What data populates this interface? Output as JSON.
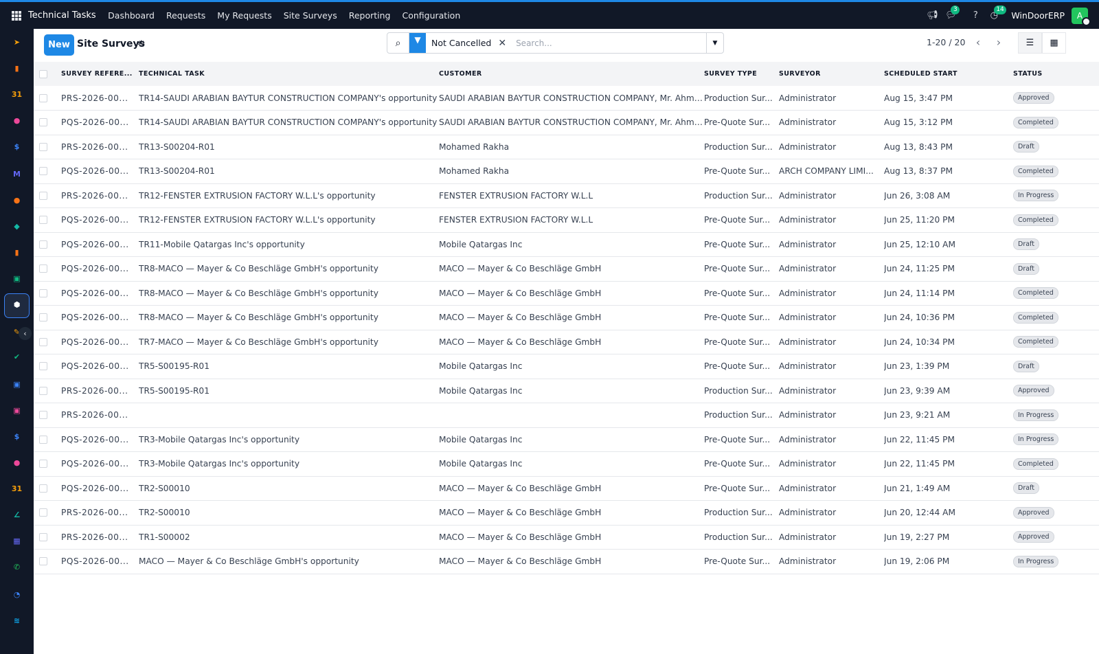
{
  "app": {
    "name": "Technical Tasks"
  },
  "menu": [
    "Dashboard",
    "Requests",
    "My Requests",
    "Site Surveys",
    "Reporting",
    "Configuration"
  ],
  "systray": {
    "messages_count": "3",
    "activities_count": "14",
    "company": "WinDoorERP",
    "avatar_initial": "A"
  },
  "control": {
    "new_label": "New",
    "title": "Site Surveys",
    "facet": "Not Cancelled",
    "search_placeholder": "Search...",
    "pager": "1-20 / 20"
  },
  "table": {
    "columns": [
      "SURVEY REFERE...",
      "TECHNICAL TASK",
      "CUSTOMER",
      "SURVEY TYPE",
      "SURVEYOR",
      "SCHEDULED START",
      "STATUS"
    ],
    "rows": [
      {
        "ref": "PRS-2026-00...",
        "task": "TR14-SAUDI ARABIAN BAYTUR CONSTRUCTION COMPANY's opportunity",
        "customer": "SAUDI ARABIAN BAYTUR CONSTRUCTION COMPANY, Mr. Ahmad",
        "type": "Production Sur...",
        "surveyor": "Administrator",
        "start": "Aug 15, 3:47 PM",
        "status": "Approved"
      },
      {
        "ref": "PQS-2026-00...",
        "task": "TR14-SAUDI ARABIAN BAYTUR CONSTRUCTION COMPANY's opportunity",
        "customer": "SAUDI ARABIAN BAYTUR CONSTRUCTION COMPANY, Mr. Ahmad",
        "type": "Pre-Quote Sur...",
        "surveyor": "Administrator",
        "start": "Aug 15, 3:12 PM",
        "status": "Completed"
      },
      {
        "ref": "PRS-2026-00...",
        "task": "TR13-S00204-R01",
        "customer": "Mohamed Rakha",
        "type": "Production Sur...",
        "surveyor": "Administrator",
        "start": "Aug 13, 8:43 PM",
        "status": "Draft"
      },
      {
        "ref": "PQS-2026-00...",
        "task": "TR13-S00204-R01",
        "customer": "Mohamed Rakha",
        "type": "Pre-Quote Sur...",
        "surveyor": "ARCH COMPANY LIMI...",
        "start": "Aug 13, 8:37 PM",
        "status": "Completed"
      },
      {
        "ref": "PRS-2026-00...",
        "task": "TR12-FENSTER EXTRUSION FACTORY W.L.L's opportunity",
        "customer": "FENSTER EXTRUSION FACTORY W.L.L",
        "type": "Production Sur...",
        "surveyor": "Administrator",
        "start": "Jun 26, 3:08 AM",
        "status": "In Progress"
      },
      {
        "ref": "PQS-2026-00...",
        "task": "TR12-FENSTER EXTRUSION FACTORY W.L.L's opportunity",
        "customer": "FENSTER EXTRUSION FACTORY W.L.L",
        "type": "Pre-Quote Sur...",
        "surveyor": "Administrator",
        "start": "Jun 25, 11:20 PM",
        "status": "Completed"
      },
      {
        "ref": "PQS-2026-00...",
        "task": "TR11-Mobile Qatargas Inc's opportunity",
        "customer": "Mobile Qatargas Inc",
        "type": "Pre-Quote Sur...",
        "surveyor": "Administrator",
        "start": "Jun 25, 12:10 AM",
        "status": "Draft"
      },
      {
        "ref": "PQS-2026-00...",
        "task": "TR8-MACO — Mayer & Co Beschläge GmbH's opportunity",
        "customer": "MACO — Mayer & Co Beschläge GmbH",
        "type": "Pre-Quote Sur...",
        "surveyor": "Administrator",
        "start": "Jun 24, 11:25 PM",
        "status": "Draft"
      },
      {
        "ref": "PQS-2026-00...",
        "task": "TR8-MACO — Mayer & Co Beschläge GmbH's opportunity",
        "customer": "MACO — Mayer & Co Beschläge GmbH",
        "type": "Pre-Quote Sur...",
        "surveyor": "Administrator",
        "start": "Jun 24, 11:14 PM",
        "status": "Completed"
      },
      {
        "ref": "PQS-2026-00...",
        "task": "TR8-MACO — Mayer & Co Beschläge GmbH's opportunity",
        "customer": "MACO — Mayer & Co Beschläge GmbH",
        "type": "Pre-Quote Sur...",
        "surveyor": "Administrator",
        "start": "Jun 24, 10:36 PM",
        "status": "Completed"
      },
      {
        "ref": "PQS-2026-00...",
        "task": "TR7-MACO — Mayer & Co Beschläge GmbH's opportunity",
        "customer": "MACO — Mayer & Co Beschläge GmbH",
        "type": "Pre-Quote Sur...",
        "surveyor": "Administrator",
        "start": "Jun 24, 10:34 PM",
        "status": "Completed"
      },
      {
        "ref": "PQS-2026-00...",
        "task": "TR5-S00195-R01",
        "customer": "Mobile Qatargas Inc",
        "type": "Pre-Quote Sur...",
        "surveyor": "Administrator",
        "start": "Jun 23, 1:39 PM",
        "status": "Draft"
      },
      {
        "ref": "PRS-2026-00...",
        "task": "TR5-S00195-R01",
        "customer": "Mobile Qatargas Inc",
        "type": "Production Sur...",
        "surveyor": "Administrator",
        "start": "Jun 23, 9:39 AM",
        "status": "Approved"
      },
      {
        "ref": "PRS-2026-00...",
        "task": "",
        "customer": "",
        "type": "Production Sur...",
        "surveyor": "Administrator",
        "start": "Jun 23, 9:21 AM",
        "status": "In Progress"
      },
      {
        "ref": "PQS-2026-00...",
        "task": "TR3-Mobile Qatargas Inc's opportunity",
        "customer": "Mobile Qatargas Inc",
        "type": "Pre-Quote Sur...",
        "surveyor": "Administrator",
        "start": "Jun 22, 11:45 PM",
        "status": "In Progress"
      },
      {
        "ref": "PQS-2026-00...",
        "task": "TR3-Mobile Qatargas Inc's opportunity",
        "customer": "Mobile Qatargas Inc",
        "type": "Pre-Quote Sur...",
        "surveyor": "Administrator",
        "start": "Jun 22, 11:45 PM",
        "status": "Completed"
      },
      {
        "ref": "PQS-2026-00...",
        "task": "TR2-S00010",
        "customer": "MACO — Mayer & Co Beschläge GmbH",
        "type": "Pre-Quote Sur...",
        "surveyor": "Administrator",
        "start": "Jun 21, 1:49 AM",
        "status": "Draft"
      },
      {
        "ref": "PRS-2026-00...",
        "task": "TR2-S00010",
        "customer": "MACO — Mayer & Co Beschläge GmbH",
        "type": "Production Sur...",
        "surveyor": "Administrator",
        "start": "Jun 20, 12:44 AM",
        "status": "Approved"
      },
      {
        "ref": "PRS-2026-00...",
        "task": "TR1-S00002",
        "customer": "MACO — Mayer & Co Beschläge GmbH",
        "type": "Production Sur...",
        "surveyor": "Administrator",
        "start": "Jun 19, 2:27 PM",
        "status": "Approved"
      },
      {
        "ref": "PQS-2026-00...",
        "task": "MACO — Mayer & Co Beschläge GmbH's opportunity",
        "customer": "MACO — Mayer & Co Beschläge GmbH",
        "type": "Pre-Quote Sur...",
        "surveyor": "Administrator",
        "start": "Jun 19, 2:06 PM",
        "status": "In Progress"
      }
    ]
  },
  "dock": [
    {
      "icon": "paper-plane-icon",
      "color": "#f59e0b",
      "glyph": "➤"
    },
    {
      "icon": "bar-chart-icon",
      "color": "#f97316",
      "glyph": "▮"
    },
    {
      "icon": "calendar-icon",
      "color": "#f59e0b",
      "glyph": "31"
    },
    {
      "icon": "team-icon",
      "color": "#ec4899",
      "glyph": "●"
    },
    {
      "icon": "dollar-icon",
      "color": "#3b82f6",
      "glyph": "$"
    },
    {
      "icon": "mail-icon",
      "color": "#6366f1",
      "glyph": "M"
    },
    {
      "icon": "chat-bubble-icon",
      "color": "#f97316",
      "glyph": "●"
    },
    {
      "icon": "megaphone-icon",
      "color": "#14b8a6",
      "glyph": "◆"
    },
    {
      "icon": "reports-icon",
      "color": "#f97316",
      "glyph": "▮"
    },
    {
      "icon": "contacts-icon",
      "color": "#10b981",
      "glyph": "▣"
    },
    {
      "icon": "cube-icon",
      "color": "#ffffff",
      "glyph": "⬢"
    },
    {
      "icon": "palette-icon",
      "color": "#f59e0b",
      "glyph": "✎"
    },
    {
      "icon": "checkmark-icon",
      "color": "#10b981",
      "glyph": "✔"
    },
    {
      "icon": "monitor-icon",
      "color": "#3b82f6",
      "glyph": "▣"
    },
    {
      "icon": "box-icon",
      "color": "#ec4899",
      "glyph": "▣"
    },
    {
      "icon": "invoice-icon",
      "color": "#3b82f6",
      "glyph": "$"
    },
    {
      "icon": "employees-icon",
      "color": "#ec4899",
      "glyph": "●"
    },
    {
      "icon": "calendar-alt-icon",
      "color": "#f59e0b",
      "glyph": "31"
    },
    {
      "icon": "sign-icon",
      "color": "#14b8a6",
      "glyph": "∠"
    },
    {
      "icon": "dashboard-icon",
      "color": "#6366f1",
      "glyph": "▦"
    },
    {
      "icon": "whatsapp-icon",
      "color": "#22c55e",
      "glyph": "✆"
    },
    {
      "icon": "time-off-icon",
      "color": "#3b82f6",
      "glyph": "◔"
    },
    {
      "icon": "discuss-icon",
      "color": "#0ea5e9",
      "glyph": "≋"
    }
  ]
}
